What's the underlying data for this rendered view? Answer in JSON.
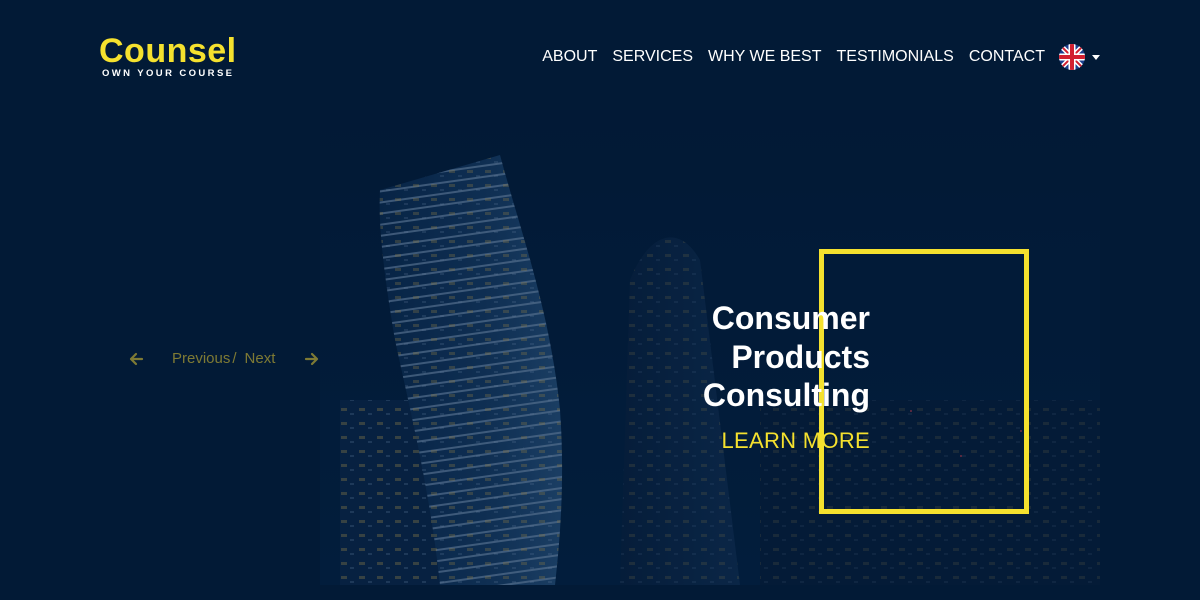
{
  "brand": {
    "name": "Counsel",
    "tagline": "OWN YOUR COURSE"
  },
  "nav": {
    "items": [
      {
        "label": "ABOUT"
      },
      {
        "label": "SERVICES"
      },
      {
        "label": "WHY WE BEST"
      },
      {
        "label": "TESTIMONIALS"
      },
      {
        "label": "CONTACT"
      }
    ],
    "language_icon": "uk-flag-icon"
  },
  "slider": {
    "prev_label": "Previous",
    "separator": "/",
    "next_label": "Next",
    "prev_icon": "arrow-left-icon",
    "next_icon": "arrow-right-icon"
  },
  "hero": {
    "lines": [
      "Consumer",
      "Products",
      "Consulting"
    ],
    "cta": "LEARN MORE"
  },
  "colors": {
    "background": "#021a36",
    "accent": "#f5e12e",
    "muted_accent": "#7e7a34",
    "text": "#ffffff"
  }
}
